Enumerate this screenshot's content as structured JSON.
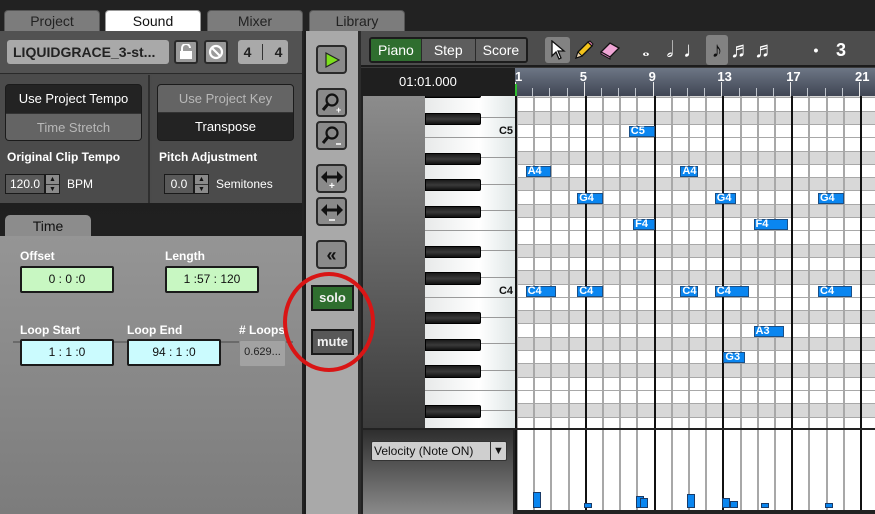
{
  "main_tabs": [
    {
      "label": "Project",
      "active": false
    },
    {
      "label": "Sound",
      "active": true
    },
    {
      "label": "Mixer",
      "active": false
    },
    {
      "label": "Library",
      "active": false
    }
  ],
  "clip": {
    "name": "LIQUIDGRACE_3-st...",
    "lock_icon": "lock-open-icon",
    "disable_icon": "no-entry-icon",
    "time_signature": {
      "numerator": "4",
      "denominator": "4"
    }
  },
  "tempo": {
    "options": [
      {
        "label": "Use Project Tempo",
        "active": true
      },
      {
        "label": "Time Stretch",
        "active": false
      }
    ],
    "label": "Original Clip Tempo",
    "value": "120.0",
    "unit": "BPM"
  },
  "pitch": {
    "options": [
      {
        "label": "Use Project Key",
        "active": false
      },
      {
        "label": "Transpose",
        "active": true
      }
    ],
    "label": "Pitch Adjustment",
    "value": "0.0",
    "unit": "Semitones"
  },
  "time_panel": {
    "tab_label": "Time",
    "offset": {
      "label": "Offset",
      "value": "0 : 0  :0"
    },
    "length": {
      "label": "Length",
      "value": "1 :57 : 120"
    },
    "loop_start": {
      "label": "Loop Start",
      "value": "1 : 1  :0"
    },
    "loop_end": {
      "label": "Loop End",
      "value": "94 : 1  :0"
    },
    "loops": {
      "label": "# Loops",
      "value": "0.629..."
    }
  },
  "mid_toolbar": {
    "buttons": [
      "play-icon",
      "zoom-in-icon",
      "zoom-out-icon",
      "expand-horizontal-icon",
      "shrink-horizontal-icon",
      "collapse-left-icon"
    ],
    "solo_label": "solo",
    "mute_label": "mute"
  },
  "editor": {
    "modes": [
      {
        "label": "Piano",
        "active": true
      },
      {
        "label": "Step",
        "active": false
      },
      {
        "label": "Score",
        "active": false
      }
    ],
    "tools": [
      "pointer-icon",
      "pencil-icon",
      "eraser-icon"
    ],
    "note_values": [
      "whole-note",
      "half-note",
      "quarter-note",
      "eighth-note",
      "sixteenth-note",
      "thirty-second-note"
    ],
    "selected_note_value": "eighth-note",
    "dot_label": "•",
    "triplet_label": "3",
    "position": "01:01.000",
    "bar_numbers": [
      "1",
      "5",
      "9",
      "13",
      "17",
      "21"
    ],
    "key_labels": [
      "C5",
      "C4"
    ],
    "notes": [
      {
        "pitch": "C5",
        "label": "C5",
        "beat": 7.5,
        "length": 1.5
      },
      {
        "pitch": "A4",
        "label": "A4",
        "beat": 1.5,
        "length": 1.5
      },
      {
        "pitch": "A4",
        "label": "A4",
        "beat": 10.5,
        "length": 1
      },
      {
        "pitch": "G4",
        "label": "G4",
        "beat": 4.5,
        "length": 1.5
      },
      {
        "pitch": "G4",
        "label": "G4",
        "beat": 12.5,
        "length": 1.25
      },
      {
        "pitch": "G4",
        "label": "G4",
        "beat": 18.5,
        "length": 1.5
      },
      {
        "pitch": "F4",
        "label": "F4",
        "beat": 7.75,
        "length": 1.25
      },
      {
        "pitch": "F4",
        "label": "F4",
        "beat": 14.75,
        "length": 2
      },
      {
        "pitch": "C4",
        "label": "C4",
        "beat": 1.5,
        "length": 1.75
      },
      {
        "pitch": "C4",
        "label": "C4",
        "beat": 4.5,
        "length": 1.5
      },
      {
        "pitch": "C4",
        "label": "C4",
        "beat": 10.5,
        "length": 1
      },
      {
        "pitch": "C4",
        "label": "C4",
        "beat": 12.5,
        "length": 2
      },
      {
        "pitch": "C4",
        "label": "C4",
        "beat": 18.5,
        "length": 2
      },
      {
        "pitch": "A3",
        "label": "A3",
        "beat": 14.75,
        "length": 1.75
      },
      {
        "pitch": "G3",
        "label": "G3",
        "beat": 13,
        "length": 1.25
      }
    ],
    "velocity_lane": {
      "selector": "Velocity (Note ON)",
      "values": [
        {
          "beat": 1.5,
          "velocity": 0.45
        },
        {
          "beat": 4.5,
          "velocity": 0.15
        },
        {
          "beat": 7.5,
          "velocity": 0.35
        },
        {
          "beat": 7.75,
          "velocity": 0.3
        },
        {
          "beat": 10.5,
          "velocity": 0.4
        },
        {
          "beat": 12.5,
          "velocity": 0.3
        },
        {
          "beat": 13,
          "velocity": 0.2
        },
        {
          "beat": 14.75,
          "velocity": 0.15
        },
        {
          "beat": 18.5,
          "velocity": 0.15
        }
      ]
    }
  },
  "colors": {
    "active_green": "#2f6e2f",
    "note_blue": "#0a86f0",
    "annotation_red": "#d91515",
    "field_green": "#c8f7c2",
    "field_cyan": "#cbfbfe"
  }
}
